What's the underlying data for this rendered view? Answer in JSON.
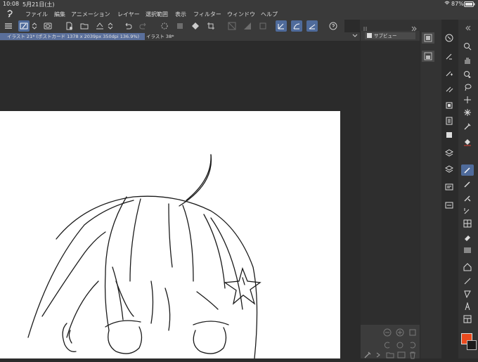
{
  "status": {
    "time": "10:08",
    "date": "5月21日(土)",
    "battery": "87%"
  },
  "menu": {
    "items": [
      "ファイル",
      "編集",
      "アニメーション",
      "レイヤー",
      "選択範囲",
      "表示",
      "フィルター",
      "ウィンドウ",
      "ヘルプ"
    ]
  },
  "tabs": [
    {
      "label": "イラスト 21* (ポストカード 1378 x 2039px 350dpi 136.9%)"
    },
    {
      "label": "イラスト 38*"
    }
  ],
  "subview": {
    "title": "サブビュー"
  },
  "colors": {
    "accent": "#4f6b9b",
    "main_color": "#ea4a1e",
    "sub_color": "#1a1a1a"
  },
  "icons": {
    "toolbar": [
      "menu-icon",
      "pen-select-icon",
      "chevron-updown-icon",
      "eye-icon",
      "new-file-icon",
      "open-folder-icon",
      "chevron-updown-icon",
      "save-icon",
      "chevron-updown-icon",
      "undo-icon",
      "redo-icon",
      "loading-icon",
      "transform-icon",
      "fill-icon",
      "crop-icon",
      "deselect-icon",
      "clear-icon",
      "invert-icon",
      "select-icon",
      "pen-stabilize-icon",
      "curve-icon",
      "line-icon",
      "help-icon"
    ],
    "panel": [
      "navigator-icon",
      "tool-property-icon",
      "brush-size-icon",
      "brush-settings-icon",
      "layer-icon",
      "material-icon",
      "layer-property-icon",
      "stack-icon",
      "layers-icon",
      "history-icon",
      "timeline-icon"
    ],
    "tools": [
      "zoom-icon",
      "hand-icon",
      "operation-icon",
      "lasso-icon",
      "move-icon",
      "star-icon",
      "eyedropper-icon",
      "fill-bucket-icon",
      "g-pen-icon",
      "pencil-icon",
      "marker-icon",
      "airbrush-icon",
      "decoration-icon",
      "eraser-icon",
      "blend-icon",
      "ruler-icon",
      "line-tool-icon",
      "figure-icon",
      "text-icon",
      "frame-icon"
    ]
  }
}
